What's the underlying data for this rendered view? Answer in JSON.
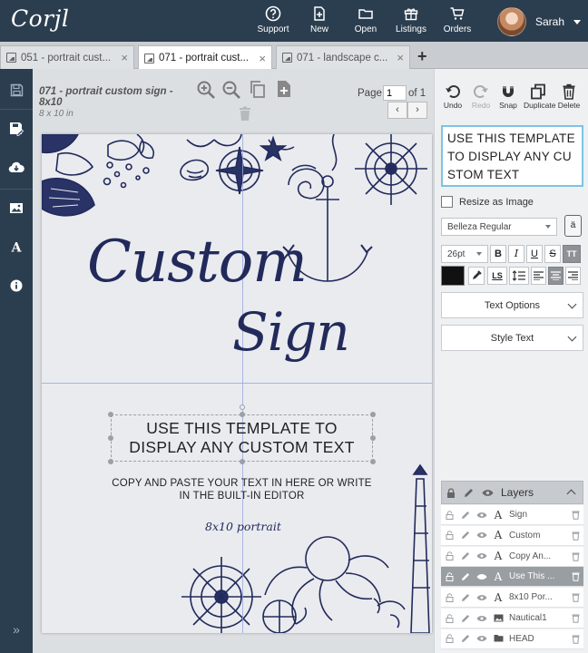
{
  "app": {
    "logo": "Corjl",
    "nav": [
      {
        "label": "Support",
        "icon": "help-circle-icon"
      },
      {
        "label": "New",
        "icon": "new-file-icon"
      },
      {
        "label": "Open",
        "icon": "folder-icon"
      },
      {
        "label": "Listings",
        "icon": "gift-icon"
      },
      {
        "label": "Orders",
        "icon": "cart-icon"
      }
    ],
    "user": {
      "name": "Sarah"
    }
  },
  "tabs": [
    {
      "label": "051 - portrait cust...",
      "active": false
    },
    {
      "label": "071 - portrait cust...",
      "active": true
    },
    {
      "label": "071 - landscape c...",
      "active": false
    }
  ],
  "tab_close": "×",
  "tab_add": "+",
  "document": {
    "title": "071 - portrait custom sign - 8x10",
    "size": "8 x 10 in",
    "page_label": "Page",
    "page_value": "1",
    "page_of": "of 1",
    "prev": "‹",
    "next": "›"
  },
  "canvas": {
    "script_line_1": "Custom",
    "script_line_2": "Sign",
    "main_text": "USE THIS TEMPLATE TO DISPLAY ANY CUSTOM TEXT",
    "sub_text": "COPY AND PASTE YOUR TEXT IN HERE OR WRITE IN THE BUILT-IN EDITOR",
    "small_script": "8x10 portrait"
  },
  "panel": {
    "tools": [
      {
        "label": "Undo",
        "icon": "undo-icon",
        "disabled": false
      },
      {
        "label": "Redo",
        "icon": "redo-icon",
        "disabled": true
      },
      {
        "label": "Snap",
        "icon": "magnet-icon",
        "disabled": false
      },
      {
        "label": "Duplicate",
        "icon": "duplicate-icon",
        "disabled": false
      },
      {
        "label": "Delete",
        "icon": "trash-icon",
        "disabled": false
      }
    ],
    "editor_text": "USE THIS TEMPLATE TO DISPLAY ANY CUSTOM TEXT",
    "resize_label": "Resize as Image",
    "font": "Belleza Regular",
    "font_badge": "ä",
    "font_size": "26pt",
    "format": {
      "bold": "B",
      "italic": "I",
      "underline": "U",
      "strike": "S",
      "caps": "TT",
      "letter_spacing": "LS"
    },
    "text_options": "Text Options",
    "style_text": "Style Text",
    "layers_title": "Layers",
    "layers": [
      {
        "name": "Sign",
        "type": "text",
        "selected": false
      },
      {
        "name": "Custom",
        "type": "text",
        "selected": false
      },
      {
        "name": "Copy An...",
        "type": "text",
        "selected": false
      },
      {
        "name": "Use This ...",
        "type": "text",
        "selected": true
      },
      {
        "name": "8x10 Por...",
        "type": "text",
        "selected": false
      },
      {
        "name": "Nautical1",
        "type": "image",
        "selected": false
      },
      {
        "name": "HEAD",
        "type": "folder",
        "selected": false
      }
    ]
  },
  "colors": {
    "topbar": "#2b3e50",
    "ink": "#222a5c",
    "selection": "#999ea3",
    "editor_border": "#7ec3e2"
  }
}
